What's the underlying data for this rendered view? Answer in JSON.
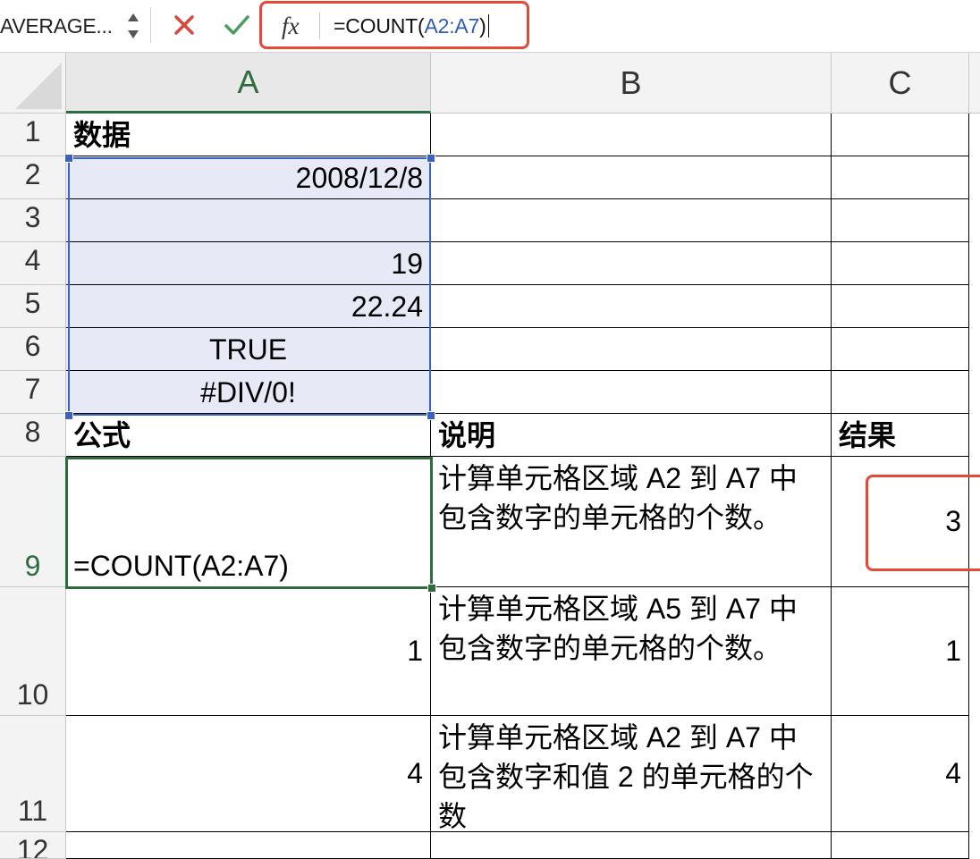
{
  "formula_bar": {
    "name_box": "AVERAGE...",
    "cancel_icon": "x-icon",
    "enter_icon": "checkmark-icon",
    "fx_label": "fx",
    "formula_prefix": "=COUNT(",
    "formula_ref": "A2:A7",
    "formula_suffix": ")"
  },
  "columns": [
    "A",
    "B",
    "C"
  ],
  "rows": [
    {
      "num": "1",
      "a": "数据",
      "b": "",
      "c": ""
    },
    {
      "num": "2",
      "a": "2008/12/8",
      "b": "",
      "c": ""
    },
    {
      "num": "3",
      "a": "",
      "b": "",
      "c": ""
    },
    {
      "num": "4",
      "a": "19",
      "b": "",
      "c": ""
    },
    {
      "num": "5",
      "a": "22.24",
      "b": "",
      "c": ""
    },
    {
      "num": "6",
      "a": "TRUE",
      "b": "",
      "c": ""
    },
    {
      "num": "7",
      "a": "#DIV/0!",
      "b": "",
      "c": ""
    },
    {
      "num": "8",
      "a": "公式",
      "b": "说明",
      "c": "结果"
    },
    {
      "num": "9",
      "a": "=COUNT(A2:A7)",
      "b": "计算单元格区域 A2 到 A7 中包含数字的单元格的个数。",
      "c": "3"
    },
    {
      "num": "10",
      "a": "1",
      "b": "计算单元格区域 A5 到 A7 中包含数字的单元格的个数。",
      "c": "1"
    },
    {
      "num": "11",
      "a": "4",
      "b": "计算单元格区域 A2 到 A7 中包含数字和值 2 的单元格的个数",
      "c": "4"
    },
    {
      "num": "12",
      "a": "",
      "b": "",
      "c": ""
    }
  ],
  "colors": {
    "accent_red": "#e24a36",
    "selection_blue": "#3a63c1",
    "active_green": "#2e6b3f",
    "range_fill": "#e7eaf6"
  }
}
